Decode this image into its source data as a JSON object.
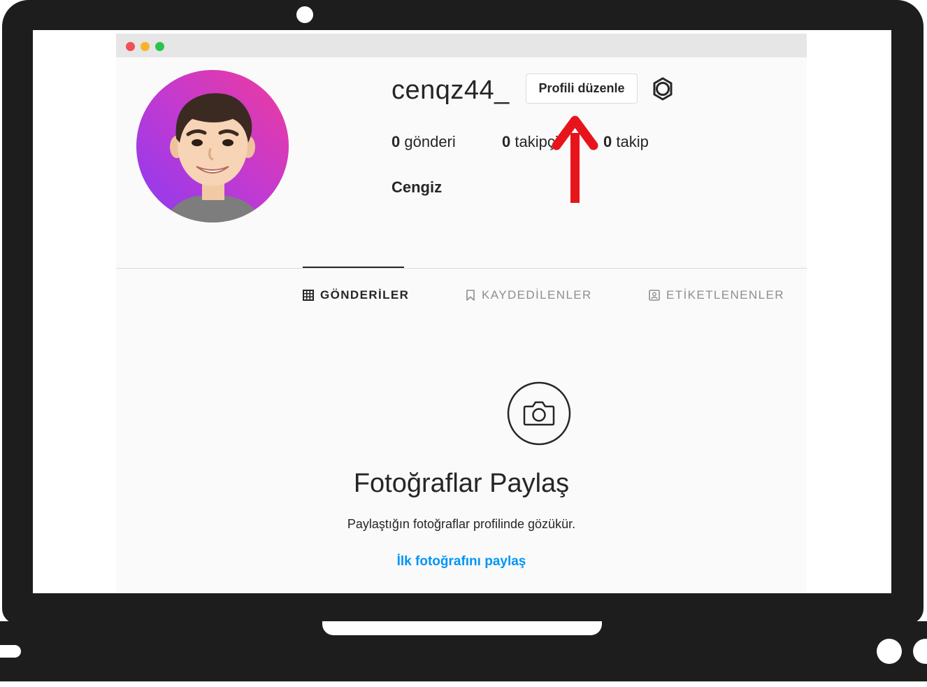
{
  "profile": {
    "username": "cenqz44_",
    "edit_button_label": "Profili düzenle",
    "full_name": "Cengiz",
    "stats": [
      {
        "count": "0",
        "label": "gönderi"
      },
      {
        "count": "0",
        "label": "takipçi"
      },
      {
        "count": "0",
        "label": "takip"
      }
    ]
  },
  "tabs": [
    {
      "label": "GÖNDERİLER",
      "icon": "grid-icon",
      "active": true
    },
    {
      "label": "KAYDEDİLENLER",
      "icon": "bookmark-icon",
      "active": false
    },
    {
      "label": "ETİKETLENENLER",
      "icon": "tagged-icon",
      "active": false
    }
  ],
  "empty_state": {
    "icon": "camera-icon",
    "title": "Fotoğraflar Paylaş",
    "subtitle": "Paylaştığın fotoğraflar profilinde gözükür.",
    "link_label": "İlk fotoğrafını paylaş"
  },
  "annotation": {
    "icon": "red-arrow-up",
    "color": "#e8141c"
  },
  "colors": {
    "link": "#0095f6",
    "text": "#262626",
    "muted": "#8e8e8e",
    "avatar_gradient": [
      "#8a3bf2",
      "#ef3b9c"
    ]
  }
}
